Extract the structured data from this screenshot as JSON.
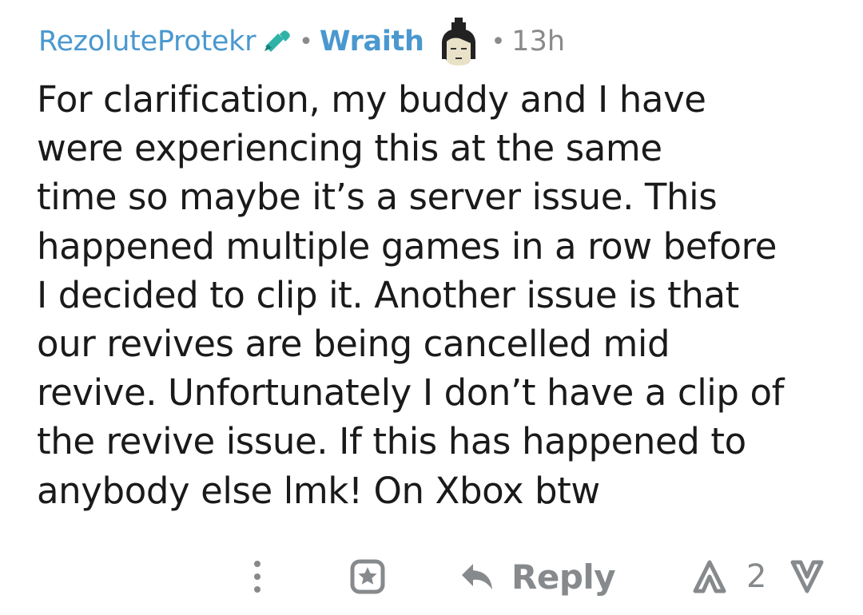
{
  "comment": {
    "author": "RezoluteProtekr",
    "author_icon": "mod-shield-pencil-icon",
    "separator": "•",
    "flair_text": "Wraith",
    "flair_icon": "wraith-avatar-icon",
    "timestamp": "13h",
    "body_lines": [
      "For clarification, my buddy and I have",
      "were experiencing this at the same",
      "time so maybe it’s a server issue. This",
      "happened multiple games in a row before",
      "I decided to clip it. Another issue is that",
      "our revives are being cancelled mid",
      "revive. Unfortunately I don’t have a clip of",
      "the revive issue. If this has happened to",
      "anybody else lmk! On Xbox btw"
    ]
  },
  "actions": {
    "more_icon": "more-vertical-icon",
    "award_icon": "award-icon",
    "reply_icon": "reply-arrow-icon",
    "reply_label": "Reply",
    "upvote_icon": "upvote-arrow-icon",
    "score": "2",
    "downvote_icon": "downvote-arrow-icon"
  },
  "colors": {
    "username": "#4a98cf",
    "body_text": "#1a1a1a",
    "muted": "#878a8c",
    "mod_icon": "#2fb3a8",
    "background": "#ffffff"
  }
}
